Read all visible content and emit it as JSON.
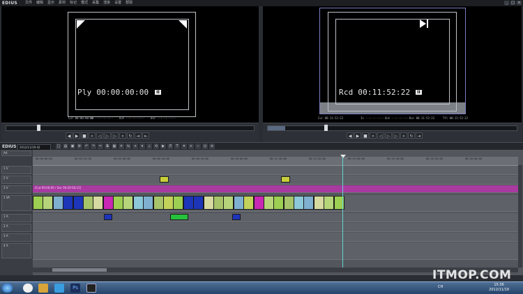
{
  "app": {
    "title": "EDIUS",
    "timeline_title": "EDIUS"
  },
  "menu": [
    "文件",
    "编辑",
    "显示",
    "素材",
    "标记",
    "模式",
    "采集",
    "渲染",
    "设置",
    "帮助"
  ],
  "window_controls": [
    "_",
    "□",
    "×"
  ],
  "player": {
    "timecode": "Ply 00:00:00:00",
    "cue": "Cur 00:00:00:00",
    "in": "In --:--:--:--",
    "out": "Out --:--:--:--",
    "dur": "Dur --:--:--:--",
    "mark": "II"
  },
  "recorder": {
    "timecode": "Rcd 00:11:52:22",
    "cue": "Cur 00:11:52:22",
    "in": "In --:--:--:--",
    "out": "Out --:--:--:--",
    "dur": "Dur 00:11:52:22",
    "ttl": "Ttl 00:11:52:22",
    "mark": "II",
    "progress": 0.07
  },
  "sequence_field": "2012/11/19-42",
  "timeline": {
    "ruler_ticks": [
      "00:00:00;00",
      "00:03:20;00",
      "00:05:00;00",
      "00:06:40;00",
      "00:08:20;00",
      "00:10:00;00",
      "00:11:40;00",
      "00:13:20;00",
      "00:15:00;00",
      "00:16:40;00",
      "00:18:20;00",
      "00:20:00;00"
    ],
    "tracks": [
      "1 V",
      "2 V",
      "3 V",
      "1 VA",
      "1 A",
      "2 A",
      "3 A",
      "4 A"
    ],
    "title_bar_text": "[Cut 00:00;00 / Dur 00:29:56;15]",
    "playhead_fraction": 0.636
  },
  "taskbar": {
    "apps": [
      "start",
      "qq",
      "explorer",
      "media",
      "photoshop",
      "edius"
    ],
    "lang": "CH",
    "time": "15:36",
    "date": "2012/11/19"
  },
  "watermark": "ITMOP.COM",
  "colors": {
    "playhead": "#67d3d3",
    "clip_green": "#9ccf52",
    "clip_blue": "#1d35b8",
    "clip_magenta": "#c828b4",
    "title_track": "#a83aa0"
  }
}
